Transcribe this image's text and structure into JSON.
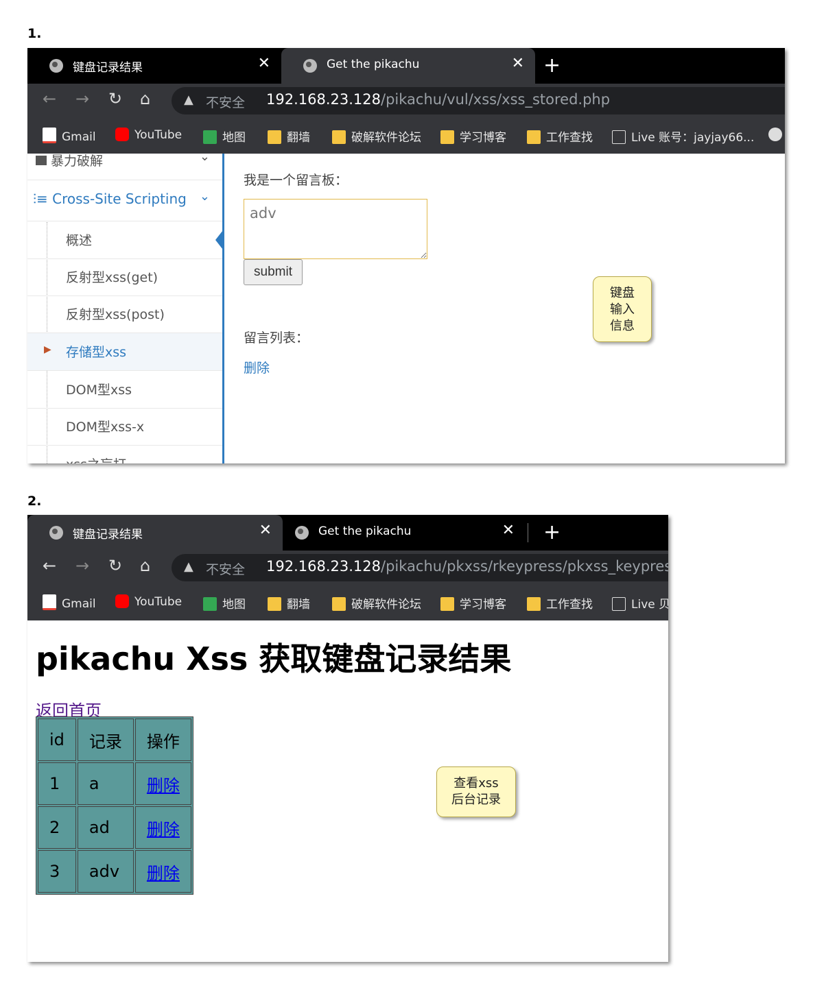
{
  "step1": "1.",
  "step2": "2.",
  "window1": {
    "tabs": [
      {
        "title": "键盘记录结果"
      },
      {
        "title": "Get the pikachu"
      }
    ],
    "new_tab": "+",
    "security": "不安全",
    "url_host": "192.168.23.128",
    "url_path": "/pikachu/vul/xss/xss_stored.php",
    "bookmarks": [
      "Gmail",
      "YouTube",
      "地图",
      "翻墙",
      "破解软件论坛",
      "学习博客",
      "工作查找",
      "Live 账号：jayjay66..."
    ],
    "sidebar": {
      "top_section": "暴力破解",
      "section": "Cross-Site Scripting",
      "items": [
        "概述",
        "反射型xss(get)",
        "反射型xss(post)",
        "存储型xss",
        "DOM型xss",
        "DOM型xss-x",
        "xss之盲打"
      ],
      "active_index": 3
    },
    "board_label": "我是一个留言板：",
    "message_value": "adv",
    "submit_label": "submit",
    "list_label": "留言列表：",
    "delete_label": "删除",
    "callout": "键盘\n输入\n信息"
  },
  "window2": {
    "tabs": [
      {
        "title": "键盘记录结果"
      },
      {
        "title": "Get the pikachu"
      }
    ],
    "new_tab": "+",
    "security": "不安全",
    "url_host": "192.168.23.128",
    "url_path": "/pikachu/pkxss/rkeypress/pkxss_keypress_r",
    "bookmarks": [
      "Gmail",
      "YouTube",
      "地图",
      "翻墙",
      "破解软件论坛",
      "学习博客",
      "工作查找",
      "Live 贝"
    ],
    "heading": "pikachu Xss 获取键盘记录结果",
    "home_link": "返回首页",
    "table": {
      "headers": [
        "id",
        "记录",
        "操作"
      ],
      "rows": [
        {
          "id": "1",
          "record": "a",
          "action": "删除"
        },
        {
          "id": "2",
          "record": "ad",
          "action": "删除"
        },
        {
          "id": "3",
          "record": "adv",
          "action": "删除"
        }
      ]
    },
    "callout": "查看xss\n后台记录"
  },
  "colors": {
    "accent": "#2f7bbf",
    "table_bg": "#5b9a9a",
    "note_bg": "#fff9c4",
    "chrome_dark": "#35363a"
  }
}
